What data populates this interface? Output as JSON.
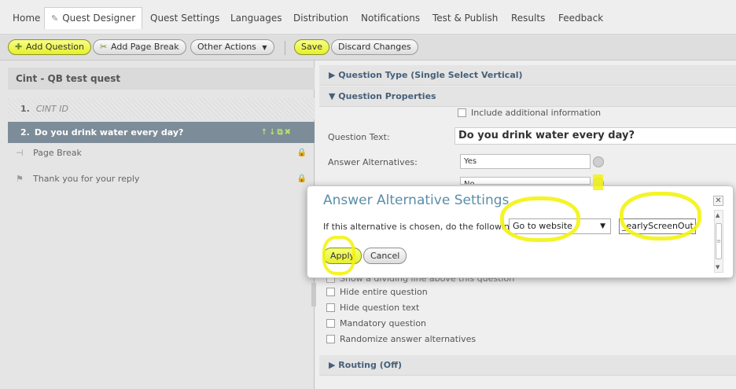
{
  "nav": {
    "tabs": [
      "Home",
      "Quest Designer",
      "Quest Settings",
      "Languages",
      "Distribution",
      "Notifications",
      "Test & Publish",
      "Results",
      "Feedback"
    ],
    "active": "Quest Designer"
  },
  "toolbar": {
    "add_question": "Add Question",
    "add_page_break": "Add Page Break",
    "other_actions": "Other Actions",
    "save": "Save",
    "discard": "Discard Changes"
  },
  "left": {
    "survey_title": "Cint - QB test quest",
    "items": [
      {
        "num": "1.",
        "label": "CINT ID"
      },
      {
        "num": "2.",
        "label": "Do you drink water every day?"
      }
    ],
    "page_break": "Page Break",
    "thank_you": "Thank you for your reply"
  },
  "right": {
    "question_type": "Question Type (Single Select Vertical)",
    "question_properties": "Question Properties",
    "include_additional": "Include additional information",
    "question_text_label": "Question Text:",
    "question_text": "Do you drink water every day?",
    "answer_alternatives_label": "Answer Alternatives:",
    "answer_values": [
      "Yes",
      "No"
    ],
    "options": [
      "Show a dividing line above this question",
      "Hide entire question",
      "Hide question text",
      "Mandatory question",
      "Randomize answer alternatives"
    ],
    "routing": "Routing (Off)"
  },
  "dialog": {
    "title": "Answer Alternative Settings",
    "instruction": "If this alternative is chosen, do the following:",
    "action_selected": "Go to website",
    "url_value": "_earlyScreenOut.asp",
    "apply": "Apply",
    "cancel": "Cancel"
  },
  "colors": {
    "highlight": "#f3f312",
    "selected_row": "#7d8c99",
    "dialog_title": "#5a8ea8"
  }
}
